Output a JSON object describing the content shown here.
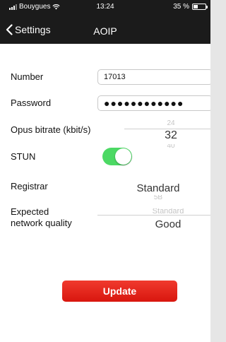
{
  "status_bar": {
    "carrier": "Bouygues",
    "time": "13:24",
    "battery_text": "35 %",
    "battery_level": 0.35,
    "icons": [
      "signal-icon",
      "wifi-icon",
      "battery-icon"
    ]
  },
  "nav": {
    "back_label": "Settings",
    "title": "AOIP"
  },
  "form": {
    "number_label": "Number",
    "number_value": "17013",
    "password_label": "Password",
    "password_mask": "●●●●●●●●●●●●",
    "bitrate_label": "Opus bitrate (kbit/s)",
    "bitrate_above": "24",
    "bitrate_selected": "32",
    "bitrate_below": "40",
    "stun_label": "STUN",
    "stun_on": true,
    "registrar_label": "Registrar",
    "registrar_selected": "Standard",
    "registrar_below": "5B",
    "quality_label_line1": "Expected",
    "quality_label_line2": "network quality",
    "quality_above": "Standard",
    "quality_selected": "Good"
  },
  "actions": {
    "update_label": "Update"
  },
  "colors": {
    "nav_background": "#1b1b1b",
    "toggle_on": "#4cd964",
    "update_button": "#e6261b",
    "page_background": "#e6e6e6"
  }
}
